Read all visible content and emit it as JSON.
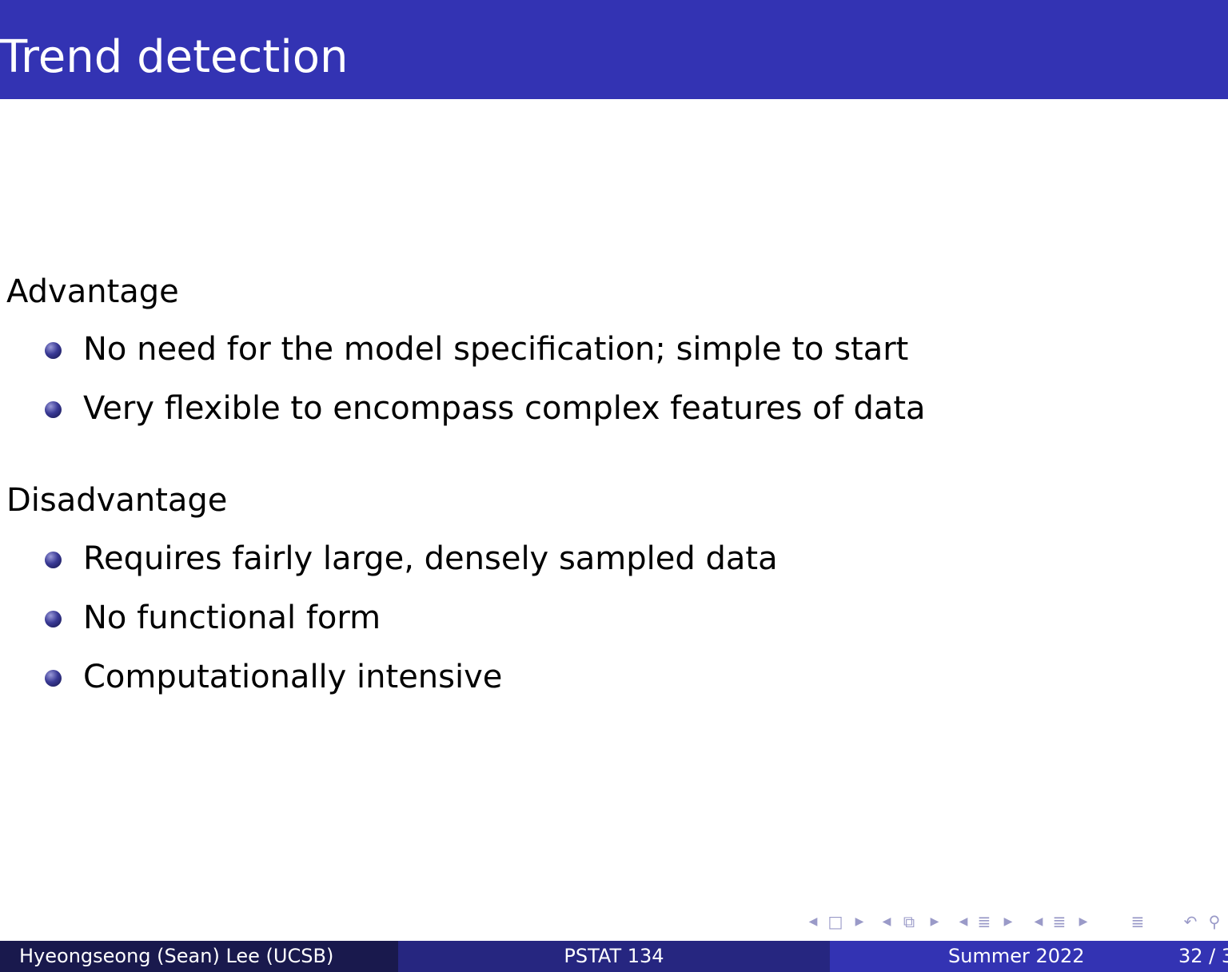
{
  "title": "Trend detection",
  "sections": [
    {
      "heading": "Advantage",
      "items": [
        "No need for the model specification; simple to start",
        "Very flexible to encompass complex features of data"
      ]
    },
    {
      "heading": "Disadvantage",
      "items": [
        "Requires fairly large, densely sampled data",
        "No functional form",
        "Computationally intensive"
      ]
    }
  ],
  "navigation": {
    "icons": [
      "nav-prev-arrow-icon",
      "frame-icon",
      "nav-next-arrow-icon",
      "nav-prev-arrow-icon",
      "subsection-icon",
      "nav-next-arrow-icon",
      "nav-prev-arrow-icon",
      "section-icon",
      "nav-next-arrow-icon",
      "nav-prev-arrow-icon",
      "section-icon",
      "nav-next-arrow-icon",
      "appendix-icon",
      "undo-icon",
      "search-icon"
    ]
  },
  "footer": {
    "author": "Hyeongseong (Sean) Lee  (UCSB)",
    "course": "PSTAT 134",
    "date": "Summer 2022",
    "page": "32 / 3"
  },
  "colors": {
    "title_bar": "#3333b3",
    "footer_left": "#19194d",
    "footer_mid": "#262680",
    "footer_right": "#3333b3",
    "nav_icons": "#9a9ac8"
  }
}
